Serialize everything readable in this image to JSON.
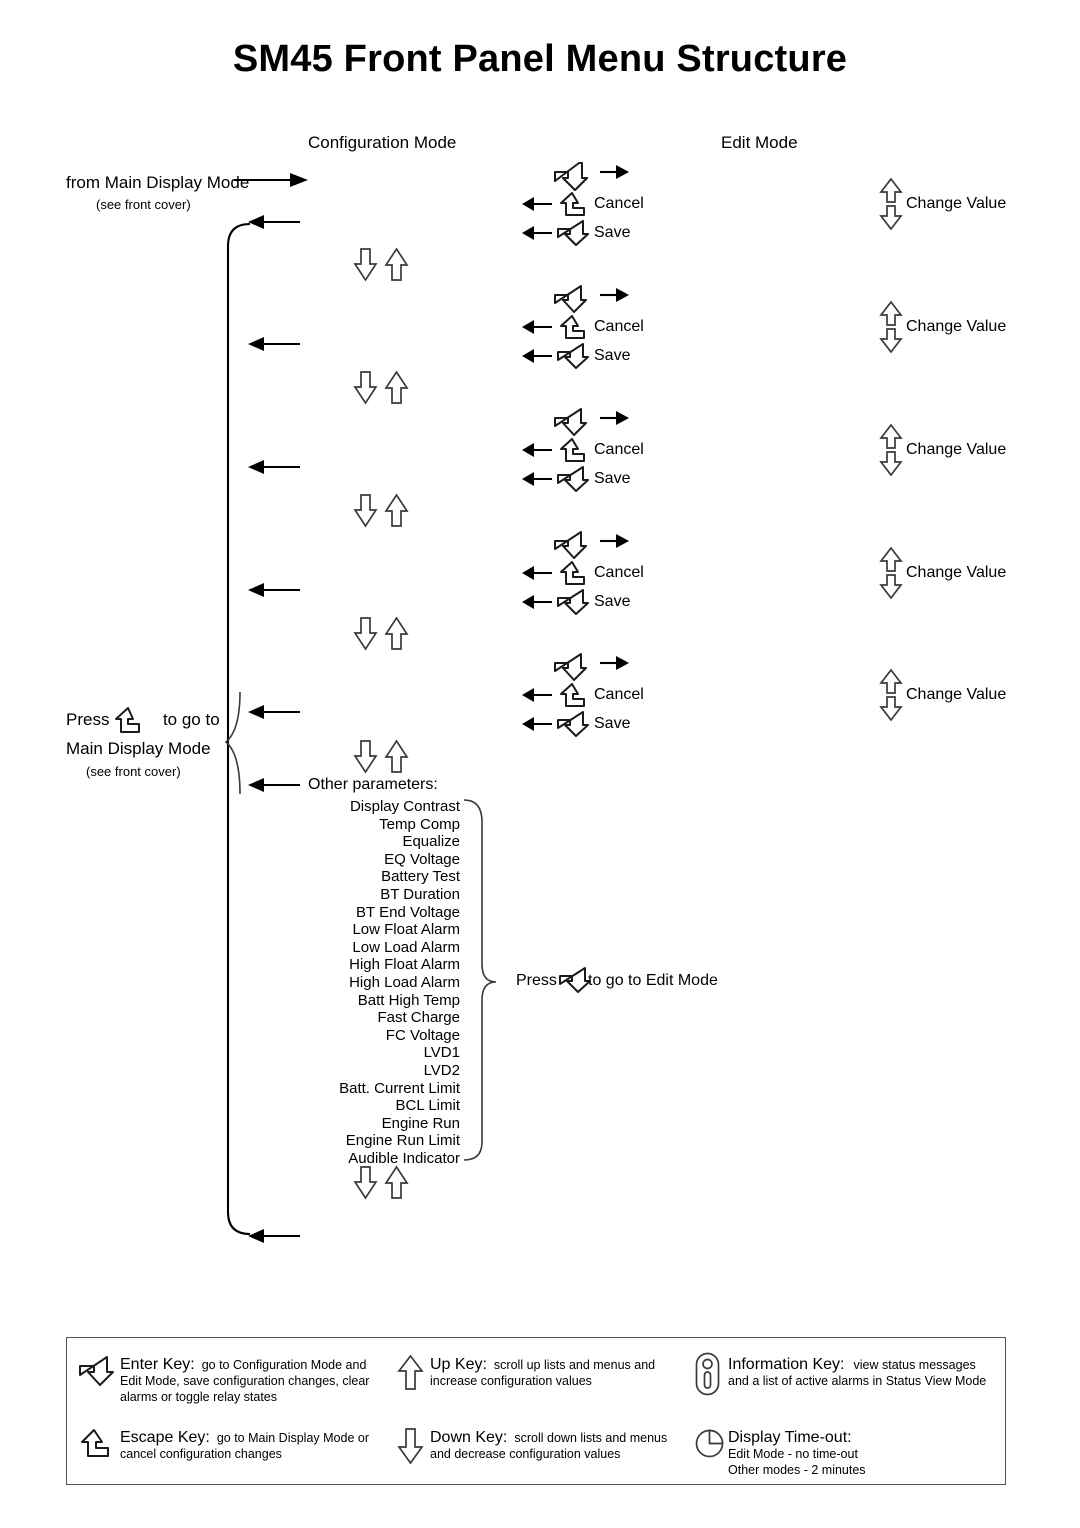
{
  "title": "SM45 Front Panel Menu Structure",
  "columns": {
    "configuration_mode": "Configuration Mode",
    "edit_mode": "Edit Mode"
  },
  "entry": {
    "label": "from Main Display Mode",
    "sub": "(see front cover)"
  },
  "exit": {
    "line1_pre": "Press",
    "line1_post": "to go to",
    "line2": "Main Display Mode",
    "sub": "(see front cover)"
  },
  "menu_blocks": [
    {
      "enter_icon": "enter-key-icon",
      "right_arrow": "right-arrow-icon",
      "cancel": "Cancel",
      "save": "Save",
      "change_value": "Change Value"
    },
    {
      "enter_icon": "enter-key-icon",
      "right_arrow": "right-arrow-icon",
      "cancel": "Cancel",
      "save": "Save",
      "change_value": "Change Value"
    },
    {
      "enter_icon": "enter-key-icon",
      "right_arrow": "right-arrow-icon",
      "cancel": "Cancel",
      "save": "Save",
      "change_value": "Change Value"
    },
    {
      "enter_icon": "enter-key-icon",
      "right_arrow": "right-arrow-icon",
      "cancel": "Cancel",
      "save": "Save",
      "change_value": "Change Value"
    },
    {
      "enter_icon": "enter-key-icon",
      "right_arrow": "right-arrow-icon",
      "cancel": "Cancel",
      "save": "Save",
      "change_value": "Change Value"
    }
  ],
  "other_parameters_heading": "Other parameters:",
  "parameters": [
    "Display Contrast",
    "Temp Comp",
    "Equalize",
    "EQ Voltage",
    "Battery Test",
    "BT Duration",
    "BT End Voltage",
    "Low Float Alarm",
    "Low Load Alarm",
    "High Float Alarm",
    "High Load Alarm",
    "Batt High Temp",
    "Fast Charge",
    "FC Voltage",
    "LVD1",
    "LVD2",
    "Batt. Current Limit",
    "BCL Limit",
    "Engine Run",
    "Engine Run Limit",
    "Audible Indicator"
  ],
  "press_edit": {
    "pre": "Press",
    "post": "to go to Edit Mode"
  },
  "legend": [
    {
      "icon": "enter-key-icon",
      "title": "Enter Key:",
      "first_line": "go to Configuration Mode and",
      "lines": [
        "Edit Mode, save configuration changes, clear",
        "alarms or toggle relay states"
      ]
    },
    {
      "icon": "escape-key-icon",
      "title": "Escape Key:",
      "first_line": "go to Main Display Mode or",
      "lines": [
        "cancel configuration changes"
      ]
    },
    {
      "icon": "up-arrow-icon",
      "title": "Up Key:",
      "first_line": "scroll up lists and menus and",
      "lines": [
        "increase configuration values"
      ]
    },
    {
      "icon": "down-arrow-icon",
      "title": "Down Key:",
      "first_line": "scroll down lists and menus",
      "lines": [
        "and decrease configuration values"
      ]
    },
    {
      "icon": "information-key-icon",
      "title": "Information Key:",
      "first_line": "view status messages",
      "lines": [
        "and a list of active alarms in Status View Mode"
      ]
    },
    {
      "icon": "clock-icon",
      "title": "Display Time-out:",
      "first_line": "",
      "lines": [
        "Edit Mode - no time-out",
        "Other modes - 2 minutes"
      ]
    }
  ],
  "colors": {
    "ink": "#000000",
    "outline": "#3a3a3a",
    "box_border": "#555555",
    "background": "#ffffff"
  }
}
